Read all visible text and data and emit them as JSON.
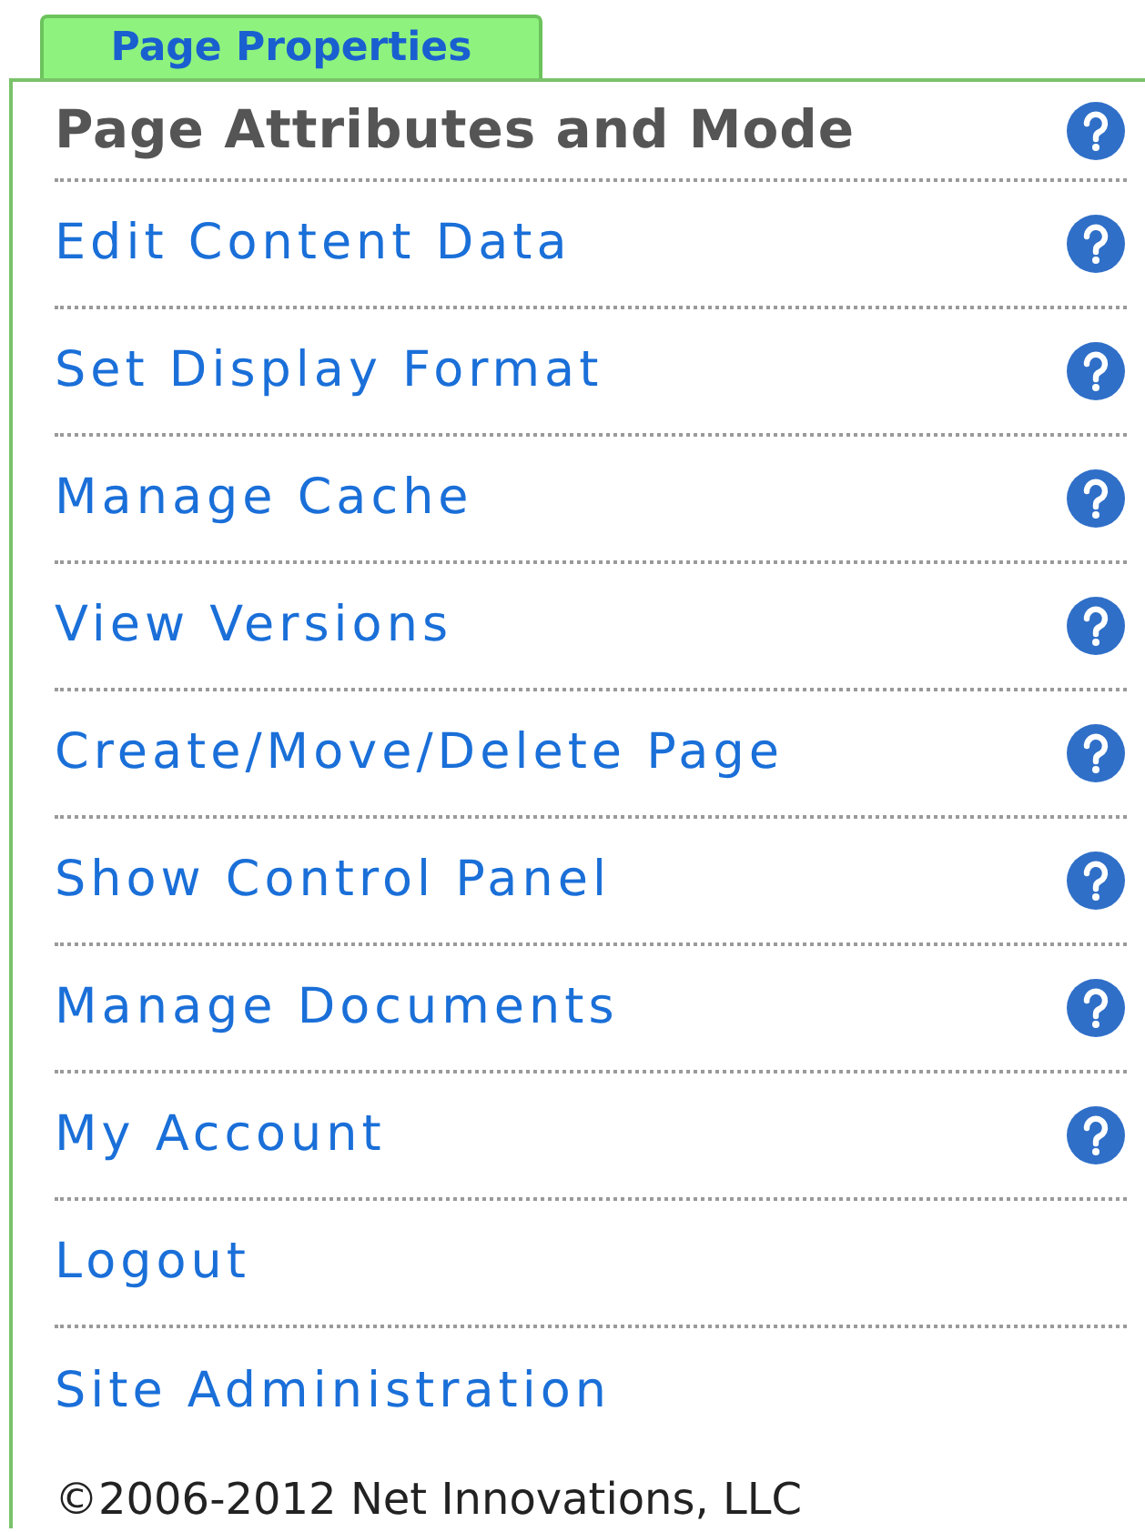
{
  "tab": {
    "label": "Page Properties"
  },
  "items": [
    {
      "kind": "heading",
      "label": "Page Attributes and Mode",
      "help": true
    },
    {
      "kind": "link",
      "label": "Edit Content Data",
      "help": true
    },
    {
      "kind": "link",
      "label": "Set Display Format",
      "help": true
    },
    {
      "kind": "link",
      "label": "Manage Cache",
      "help": true
    },
    {
      "kind": "link",
      "label": "View Versions",
      "help": true
    },
    {
      "kind": "link",
      "label": "Create/Move/Delete Page",
      "help": true
    },
    {
      "kind": "link",
      "label": "Show Control Panel",
      "help": true
    },
    {
      "kind": "link",
      "label": "Manage Documents",
      "help": true
    },
    {
      "kind": "link",
      "label": "My Account",
      "help": true
    },
    {
      "kind": "link",
      "label": "Logout",
      "help": false
    },
    {
      "kind": "link",
      "label": "Site Administration",
      "help": false
    }
  ],
  "footer": {
    "copyright": "©2006-2012 Net Innovations, LLC"
  }
}
